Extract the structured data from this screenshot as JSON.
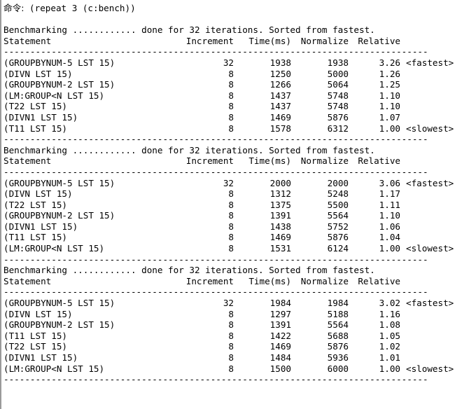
{
  "terminal": {
    "prompt_label": "命令:",
    "command": "(repeat 3 (c:bench))",
    "separator": "--------------------------------------------------------------------------------",
    "columns": {
      "statement": "Statement",
      "increment": "Increment",
      "time": "Time(ms)",
      "normalize": "Normalize",
      "relative": "Relative"
    },
    "blocks": [
      {
        "header": "Benchmarking ............ done for 32 iterations. Sorted from fastest.",
        "rows": [
          {
            "statement": "(GROUPBYNUM-5 LST 15)",
            "increment": "32",
            "time": "1938",
            "normalize": "1938",
            "relative": "3.26",
            "note": "<fastest>"
          },
          {
            "statement": "(DIVN LST 15)",
            "increment": "8",
            "time": "1250",
            "normalize": "5000",
            "relative": "1.26",
            "note": ""
          },
          {
            "statement": "(GROUPBYNUM-2 LST 15)",
            "increment": "8",
            "time": "1266",
            "normalize": "5064",
            "relative": "1.25",
            "note": ""
          },
          {
            "statement": "(LM:GROUP<N LST 15)",
            "increment": "8",
            "time": "1437",
            "normalize": "5748",
            "relative": "1.10",
            "note": ""
          },
          {
            "statement": "(T22 LST 15)",
            "increment": "8",
            "time": "1437",
            "normalize": "5748",
            "relative": "1.10",
            "note": ""
          },
          {
            "statement": "(DIVN1 LST 15)",
            "increment": "8",
            "time": "1469",
            "normalize": "5876",
            "relative": "1.07",
            "note": ""
          },
          {
            "statement": "(T11 LST 15)",
            "increment": "8",
            "time": "1578",
            "normalize": "6312",
            "relative": "1.00",
            "note": "<slowest>"
          }
        ]
      },
      {
        "header": "Benchmarking ............ done for 32 iterations. Sorted from fastest.",
        "rows": [
          {
            "statement": "(GROUPBYNUM-5 LST 15)",
            "increment": "32",
            "time": "2000",
            "normalize": "2000",
            "relative": "3.06",
            "note": "<fastest>"
          },
          {
            "statement": "(DIVN LST 15)",
            "increment": "8",
            "time": "1312",
            "normalize": "5248",
            "relative": "1.17",
            "note": ""
          },
          {
            "statement": "(T22 LST 15)",
            "increment": "8",
            "time": "1375",
            "normalize": "5500",
            "relative": "1.11",
            "note": ""
          },
          {
            "statement": "(GROUPBYNUM-2 LST 15)",
            "increment": "8",
            "time": "1391",
            "normalize": "5564",
            "relative": "1.10",
            "note": ""
          },
          {
            "statement": "(DIVN1 LST 15)",
            "increment": "8",
            "time": "1438",
            "normalize": "5752",
            "relative": "1.06",
            "note": ""
          },
          {
            "statement": "(T11 LST 15)",
            "increment": "8",
            "time": "1469",
            "normalize": "5876",
            "relative": "1.04",
            "note": ""
          },
          {
            "statement": "(LM:GROUP<N LST 15)",
            "increment": "8",
            "time": "1531",
            "normalize": "6124",
            "relative": "1.00",
            "note": "<slowest>"
          }
        ]
      },
      {
        "header": "Benchmarking ............ done for 32 iterations. Sorted from fastest.",
        "rows": [
          {
            "statement": "(GROUPBYNUM-5 LST 15)",
            "increment": "32",
            "time": "1984",
            "normalize": "1984",
            "relative": "3.02",
            "note": "<fastest>"
          },
          {
            "statement": "(DIVN LST 15)",
            "increment": "8",
            "time": "1297",
            "normalize": "5188",
            "relative": "1.16",
            "note": ""
          },
          {
            "statement": "(GROUPBYNUM-2 LST 15)",
            "increment": "8",
            "time": "1391",
            "normalize": "5564",
            "relative": "1.08",
            "note": ""
          },
          {
            "statement": "(T11 LST 15)",
            "increment": "8",
            "time": "1422",
            "normalize": "5688",
            "relative": "1.05",
            "note": ""
          },
          {
            "statement": "(T22 LST 15)",
            "increment": "8",
            "time": "1469",
            "normalize": "5876",
            "relative": "1.02",
            "note": ""
          },
          {
            "statement": "(DIVN1 LST 15)",
            "increment": "8",
            "time": "1484",
            "normalize": "5936",
            "relative": "1.01",
            "note": ""
          },
          {
            "statement": "(LM:GROUP<N LST 15)",
            "increment": "8",
            "time": "1500",
            "normalize": "6000",
            "relative": "1.00",
            "note": "<slowest>"
          }
        ]
      }
    ]
  },
  "colors": {
    "background": "#ffffff",
    "text": "#000000",
    "border": "#9a9a9a"
  }
}
